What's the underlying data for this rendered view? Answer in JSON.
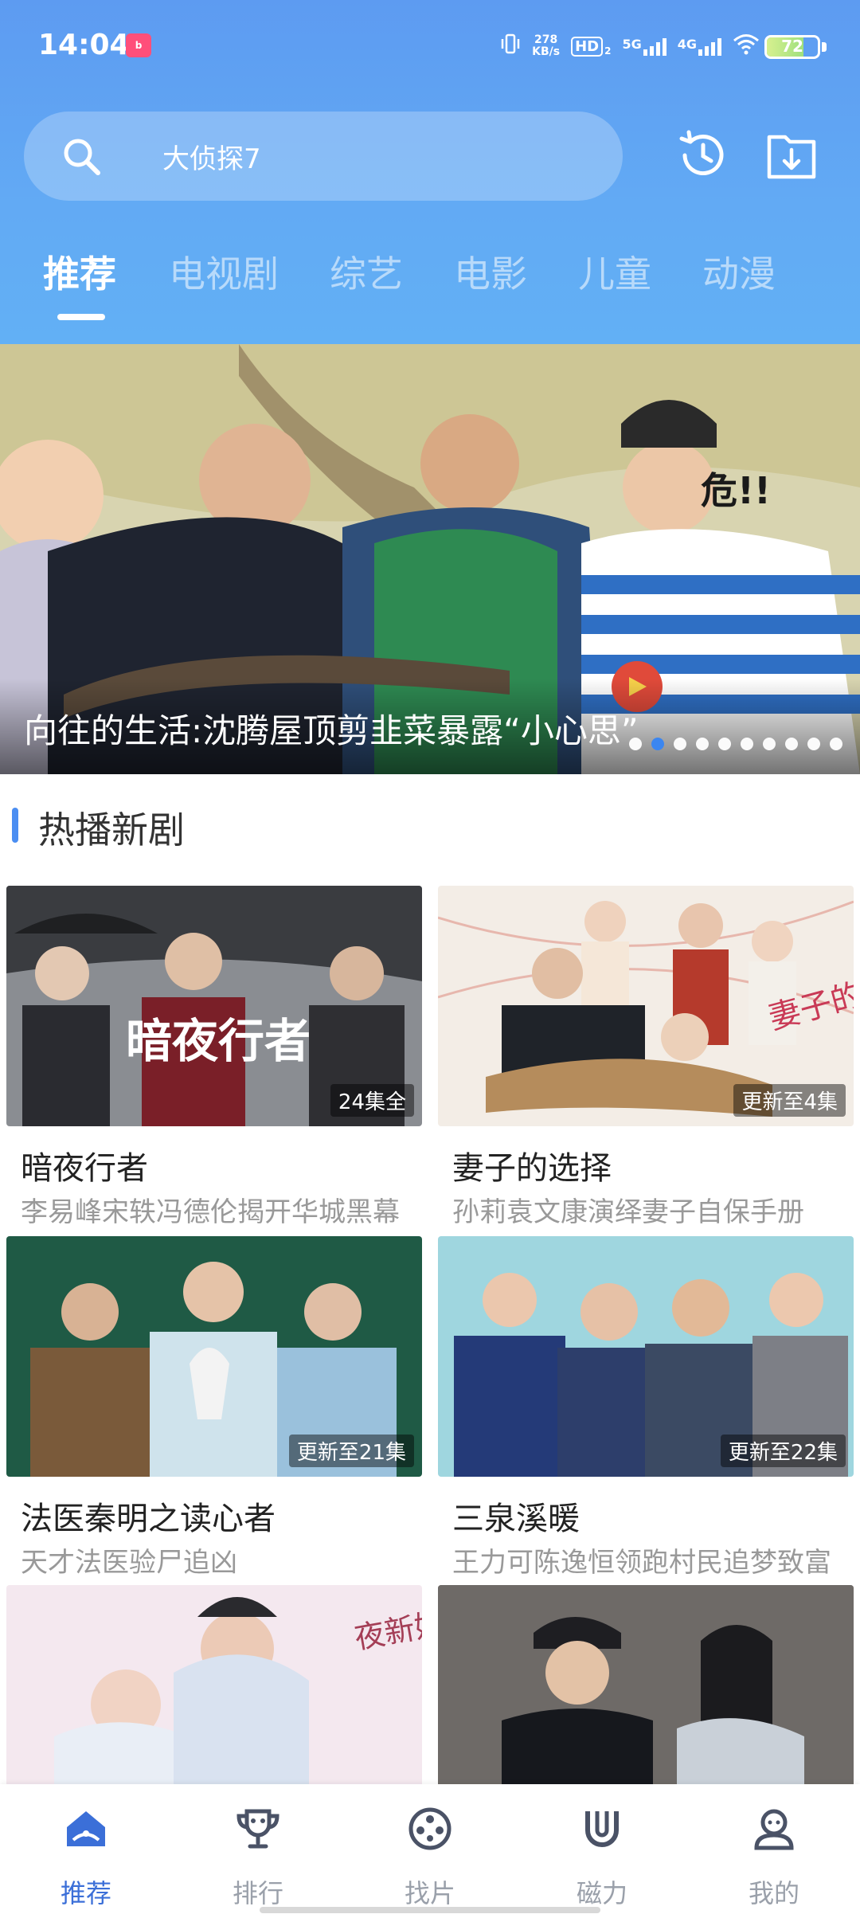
{
  "status_bar": {
    "time": "14:04",
    "app_icon_text": "bilibili",
    "net_speed_value": "278",
    "net_speed_unit": "KB/s",
    "hd_label": "HD",
    "hd_sub": "2",
    "sig1_label": "5G",
    "sig2_label": "4G",
    "battery_level": "72"
  },
  "search": {
    "query": "大侦探7"
  },
  "tabs": [
    {
      "label": "推荐",
      "active": true
    },
    {
      "label": "电视剧"
    },
    {
      "label": "综艺"
    },
    {
      "label": "电影"
    },
    {
      "label": "儿童"
    },
    {
      "label": "动漫"
    }
  ],
  "banner": {
    "caption": "向往的生活:沈腾屋顶剪韭菜暴露“小心思”",
    "dot_count": 10,
    "active_dot": 1
  },
  "section": {
    "title": "热播新剧"
  },
  "cards": [
    {
      "title": "暗夜行者",
      "subtitle": "李易峰宋轶冯德伦揭开华城黑幕",
      "badge": "24集全",
      "thumb_overlay": "暗夜行者"
    },
    {
      "title": "妻子的选择",
      "subtitle": "孙莉袁文康演绎妻子自保手册",
      "badge": "更新至4集",
      "thumb_overlay": "妻子的选择"
    },
    {
      "title": "法医秦明之读心者",
      "subtitle": "天才法医验尸追凶",
      "badge": "更新至21集"
    },
    {
      "title": "三泉溪暖",
      "subtitle": "王力可陈逸恒领跑村民追梦致富",
      "badge": "更新至22集"
    },
    {
      "title": "",
      "subtitle": "",
      "badge": "",
      "thumb_overlay": "夜新娘 第二季"
    },
    {
      "title": "",
      "subtitle": "",
      "badge": ""
    }
  ],
  "bottom_nav": [
    {
      "label": "推荐",
      "icon": "home-icon",
      "active": true
    },
    {
      "label": "排行",
      "icon": "trophy-icon"
    },
    {
      "label": "找片",
      "icon": "film-reel-icon"
    },
    {
      "label": "磁力",
      "icon": "magnet-icon"
    },
    {
      "label": "我的",
      "icon": "user-icon"
    }
  ],
  "colors": {
    "header": "#5d9bf1",
    "accent": "#3b6fd8",
    "section_bar": "#4b8ef2"
  }
}
